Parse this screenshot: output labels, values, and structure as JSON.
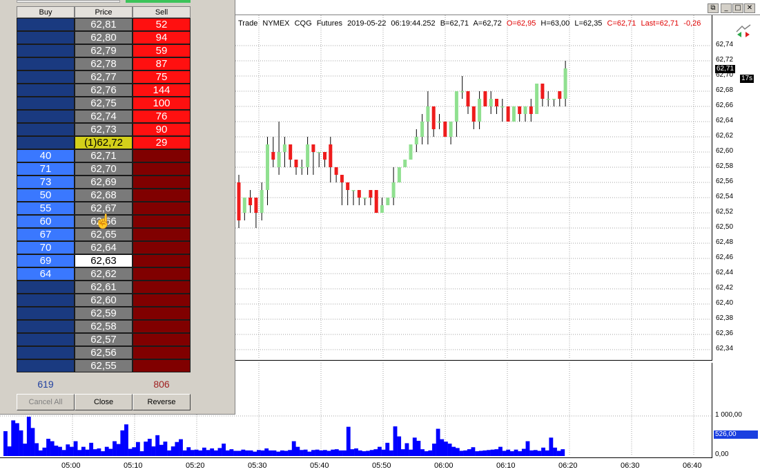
{
  "window_controls": {
    "restore": "⧉",
    "minimize": "_",
    "maximize": "□",
    "close": "✕"
  },
  "dom": {
    "headers": {
      "buy": "Buy",
      "price": "Price",
      "sell": "Sell"
    },
    "rows": [
      {
        "buy": "",
        "price": "62,81",
        "sell": "52",
        "kind": "ask"
      },
      {
        "buy": "",
        "price": "62,80",
        "sell": "94",
        "kind": "ask"
      },
      {
        "buy": "",
        "price": "62,79",
        "sell": "59",
        "kind": "ask"
      },
      {
        "buy": "",
        "price": "62,78",
        "sell": "87",
        "kind": "ask"
      },
      {
        "buy": "",
        "price": "62,77",
        "sell": "75",
        "kind": "ask"
      },
      {
        "buy": "",
        "price": "62,76",
        "sell": "144",
        "kind": "ask"
      },
      {
        "buy": "",
        "price": "62,75",
        "sell": "100",
        "kind": "ask"
      },
      {
        "buy": "",
        "price": "62,74",
        "sell": "76",
        "kind": "ask"
      },
      {
        "buy": "",
        "price": "62,73",
        "sell": "90",
        "kind": "ask"
      },
      {
        "buy": "",
        "price": "(1)62,72",
        "sell": "29",
        "kind": "last"
      },
      {
        "buy": "40",
        "price": "62,71",
        "sell": "",
        "kind": "bid"
      },
      {
        "buy": "71",
        "price": "62,70",
        "sell": "",
        "kind": "bid"
      },
      {
        "buy": "73",
        "price": "62,69",
        "sell": "",
        "kind": "bid"
      },
      {
        "buy": "50",
        "price": "62,68",
        "sell": "",
        "kind": "bid"
      },
      {
        "buy": "55",
        "price": "62,67",
        "sell": "",
        "kind": "bid"
      },
      {
        "buy": "60",
        "price": "62,66",
        "sell": "",
        "kind": "bid"
      },
      {
        "buy": "67",
        "price": "62,65",
        "sell": "",
        "kind": "bid"
      },
      {
        "buy": "70",
        "price": "62,64",
        "sell": "",
        "kind": "bid"
      },
      {
        "buy": "69",
        "price": "62,63",
        "sell": "",
        "kind": "bid-white"
      },
      {
        "buy": "64",
        "price": "62,62",
        "sell": "",
        "kind": "bid"
      },
      {
        "buy": "",
        "price": "62,61",
        "sell": "",
        "kind": "empty"
      },
      {
        "buy": "",
        "price": "62,60",
        "sell": "",
        "kind": "empty"
      },
      {
        "buy": "",
        "price": "62,59",
        "sell": "",
        "kind": "empty"
      },
      {
        "buy": "",
        "price": "62,58",
        "sell": "",
        "kind": "empty"
      },
      {
        "buy": "",
        "price": "62,57",
        "sell": "",
        "kind": "empty"
      },
      {
        "buy": "",
        "price": "62,56",
        "sell": "",
        "kind": "empty"
      },
      {
        "buy": "",
        "price": "62,55",
        "sell": "",
        "kind": "empty"
      }
    ],
    "total_buy": "619",
    "total_sell": "806",
    "buttons": {
      "cancel_all": "Cancel All",
      "close": "Close",
      "reverse": "Reverse"
    }
  },
  "chart": {
    "info": {
      "type": "Trade",
      "exchange": "NYMEX",
      "provider": "CQG",
      "kind": "Futures",
      "date": "2019-05-22",
      "time": "06:19:44.252",
      "bid": "B=62,71",
      "ask": "A=62,72",
      "open": "O=62,95",
      "high": "H=63,00",
      "low": "L=62,35",
      "close": "C=62,71",
      "last": "Last=62,71",
      "change": "-0,26"
    },
    "current_price_label": "62,71",
    "timer_label": "17s",
    "volume_current_label": "526,00",
    "colors": {
      "up": "#90e090",
      "down": "#ee1c1c",
      "volume": "#0000ff",
      "grid": "#a0a0a0"
    }
  },
  "chart_data": {
    "type": "candlestick",
    "price_ticks": [
      "62,74",
      "62,72",
      "62,70",
      "62,68",
      "62,66",
      "62,64",
      "62,62",
      "62,60",
      "62,58",
      "62,56",
      "62,54",
      "62,52",
      "62,50",
      "62,48",
      "62,46",
      "62,44",
      "62,42",
      "62,40",
      "62,38",
      "62,36",
      "62,34"
    ],
    "volume_ticks": [
      "1 000,00",
      "0,00"
    ],
    "time_ticks": [
      "05:00",
      "05:10",
      "05:20",
      "05:30",
      "05:40",
      "05:50",
      "06:00",
      "06:10",
      "06:20",
      "06:30",
      "06:40"
    ],
    "candles": [
      [
        62.56,
        62.57,
        62.5,
        62.51
      ],
      [
        62.52,
        62.54,
        62.51,
        62.54
      ],
      [
        62.54,
        62.55,
        62.52,
        62.53
      ],
      [
        62.54,
        62.54,
        62.5,
        62.52
      ],
      [
        62.52,
        62.56,
        62.51,
        62.55
      ],
      [
        62.55,
        62.62,
        62.53,
        62.61
      ],
      [
        62.6,
        62.62,
        62.58,
        62.59
      ],
      [
        62.58,
        62.64,
        62.57,
        62.6
      ],
      [
        62.6,
        62.62,
        62.58,
        62.61
      ],
      [
        62.61,
        62.61,
        62.58,
        62.59
      ],
      [
        62.59,
        62.59,
        62.57,
        62.58
      ],
      [
        62.58,
        62.59,
        62.57,
        62.58
      ],
      [
        62.58,
        62.62,
        62.57,
        62.61
      ],
      [
        62.61,
        62.61,
        62.57,
        62.6
      ],
      [
        62.6,
        62.6,
        62.58,
        62.6
      ],
      [
        62.6,
        62.6,
        62.58,
        62.59
      ],
      [
        62.61,
        62.62,
        62.56,
        62.58
      ],
      [
        62.58,
        62.58,
        62.56,
        62.57
      ],
      [
        62.57,
        62.57,
        62.53,
        62.56
      ],
      [
        62.56,
        62.56,
        62.53,
        62.55
      ],
      [
        62.55,
        62.55,
        62.53,
        62.55
      ],
      [
        62.55,
        62.55,
        62.53,
        62.54
      ],
      [
        62.54,
        62.54,
        62.53,
        62.54
      ],
      [
        62.55,
        62.55,
        62.53,
        62.54
      ],
      [
        62.55,
        62.55,
        62.53,
        62.52
      ],
      [
        62.52,
        62.54,
        62.52,
        62.53
      ],
      [
        62.53,
        62.54,
        62.53,
        62.54
      ],
      [
        62.54,
        62.58,
        62.53,
        62.56
      ],
      [
        62.56,
        62.58,
        62.56,
        62.58
      ],
      [
        62.58,
        62.59,
        62.58,
        62.59
      ],
      [
        62.59,
        62.61,
        62.59,
        62.61
      ],
      [
        62.61,
        62.63,
        62.6,
        62.62
      ],
      [
        62.62,
        62.65,
        62.61,
        62.64
      ],
      [
        62.64,
        62.68,
        62.61,
        62.66
      ],
      [
        62.66,
        62.66,
        62.62,
        62.63
      ],
      [
        62.64,
        62.65,
        62.63,
        62.64
      ],
      [
        62.64,
        62.64,
        62.62,
        62.62
      ],
      [
        62.62,
        62.64,
        62.61,
        62.64
      ],
      [
        62.64,
        62.68,
        62.62,
        62.68
      ],
      [
        62.68,
        62.7,
        62.67,
        62.68
      ],
      [
        62.68,
        62.68,
        62.65,
        62.66
      ],
      [
        62.66,
        62.66,
        62.63,
        62.64
      ],
      [
        62.64,
        62.68,
        62.63,
        62.67
      ],
      [
        62.68,
        62.68,
        62.66,
        62.66
      ],
      [
        62.66,
        62.68,
        62.65,
        62.67
      ],
      [
        62.67,
        62.67,
        62.65,
        62.66
      ],
      [
        62.66,
        62.67,
        62.64,
        62.66
      ],
      [
        62.66,
        62.66,
        62.64,
        62.64
      ],
      [
        62.64,
        62.66,
        62.64,
        62.66
      ],
      [
        62.66,
        62.66,
        62.64,
        62.65
      ],
      [
        62.65,
        62.66,
        62.64,
        62.66
      ],
      [
        62.66,
        62.67,
        62.64,
        62.65
      ],
      [
        62.65,
        62.69,
        62.65,
        62.69
      ],
      [
        62.69,
        62.69,
        62.66,
        62.67
      ],
      [
        62.67,
        62.68,
        62.66,
        62.67
      ],
      [
        62.67,
        62.67,
        62.66,
        62.67
      ],
      [
        62.68,
        62.68,
        62.66,
        62.67
      ],
      [
        62.67,
        62.72,
        62.66,
        62.71
      ]
    ],
    "volumes": [
      620,
      240,
      890,
      820,
      640,
      310,
      980,
      700,
      320,
      140,
      210,
      430,
      370,
      260,
      230,
      150,
      290,
      230,
      370,
      150,
      230,
      160,
      330,
      170,
      190,
      120,
      230,
      180,
      370,
      300,
      640,
      790,
      180,
      220,
      350,
      120,
      360,
      430,
      240,
      520,
      280,
      360,
      140,
      240,
      350,
      420,
      140,
      220,
      150,
      160,
      140,
      210,
      150,
      190,
      140,
      200,
      310,
      140,
      170,
      130,
      130,
      160,
      140,
      140,
      110,
      150,
      140,
      190,
      140,
      140,
      110,
      140,
      130,
      150,
      370,
      230,
      150,
      160,
      110,
      150,
      160,
      140,
      150,
      130,
      160,
      170,
      140,
      140,
      730,
      170,
      190,
      140,
      120,
      130,
      150,
      170,
      230,
      160,
      330,
      140,
      740,
      490,
      170,
      320,
      160,
      460,
      380,
      170,
      120,
      140,
      310,
      680,
      420,
      360,
      310,
      230,
      200,
      130,
      140,
      170,
      220,
      120,
      130,
      140,
      150,
      160,
      170,
      230,
      130,
      160,
      120,
      160,
      120,
      180,
      370,
      140,
      150,
      130,
      210,
      140,
      460,
      210,
      130,
      170
    ]
  }
}
